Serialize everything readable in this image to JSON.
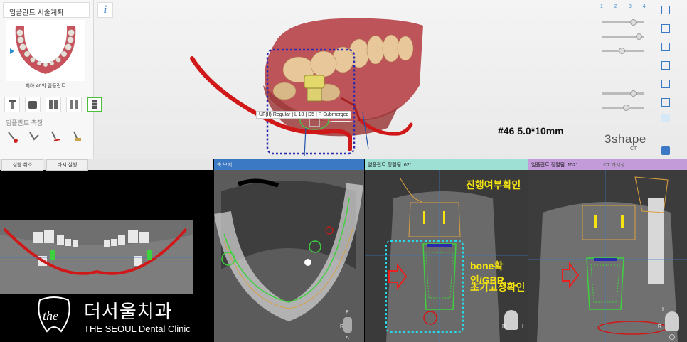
{
  "plan_panel": {
    "title": "임플란트 시술계획",
    "thumb_label": "치아 46의 임플란트",
    "measure_title": "임플란트 측정",
    "undo_label": "실행 취소",
    "redo_label": "다시 실행"
  },
  "viewport": {
    "implant_label": "UF(II) Regular | L 10 | D5 | P Submerged",
    "spec": "#46 5.0*10mm"
  },
  "right_toolbar": {
    "layer_tabs": [
      "1",
      "2",
      "3",
      "4"
    ],
    "logo": "3shape",
    "logo_sub": "CT"
  },
  "panels": {
    "cross_section": {
      "title": "축 보기"
    },
    "implant_view_1": {
      "title": "임플란트 정렬됨: 62°"
    },
    "implant_view_2": {
      "title": "임플란트 정렬됨: 152°",
      "extra": "CT 가시성"
    }
  },
  "annotations": {
    "progress_check": "진행여부확인",
    "bone_check": "bone확인/GBR",
    "stability_check": "초기고정확인"
  },
  "brand": {
    "name_ko": "더서울치과",
    "name_en": "THE SEOUL Dental Clinic",
    "logo_text": "the"
  },
  "colors": {
    "nerve": "#d01818",
    "guide_box": "#2a2ab0",
    "implant_green": "#3fd03f",
    "cyan_box": "#28d8e8",
    "annotation": "#f5e410",
    "panel_blue": "#3b79c4",
    "panel_mint": "#9fe0d4",
    "panel_purple": "#c39bd8"
  },
  "orientation_labels": [
    "P",
    "R",
    "A",
    "R",
    "I",
    "R",
    "I"
  ]
}
